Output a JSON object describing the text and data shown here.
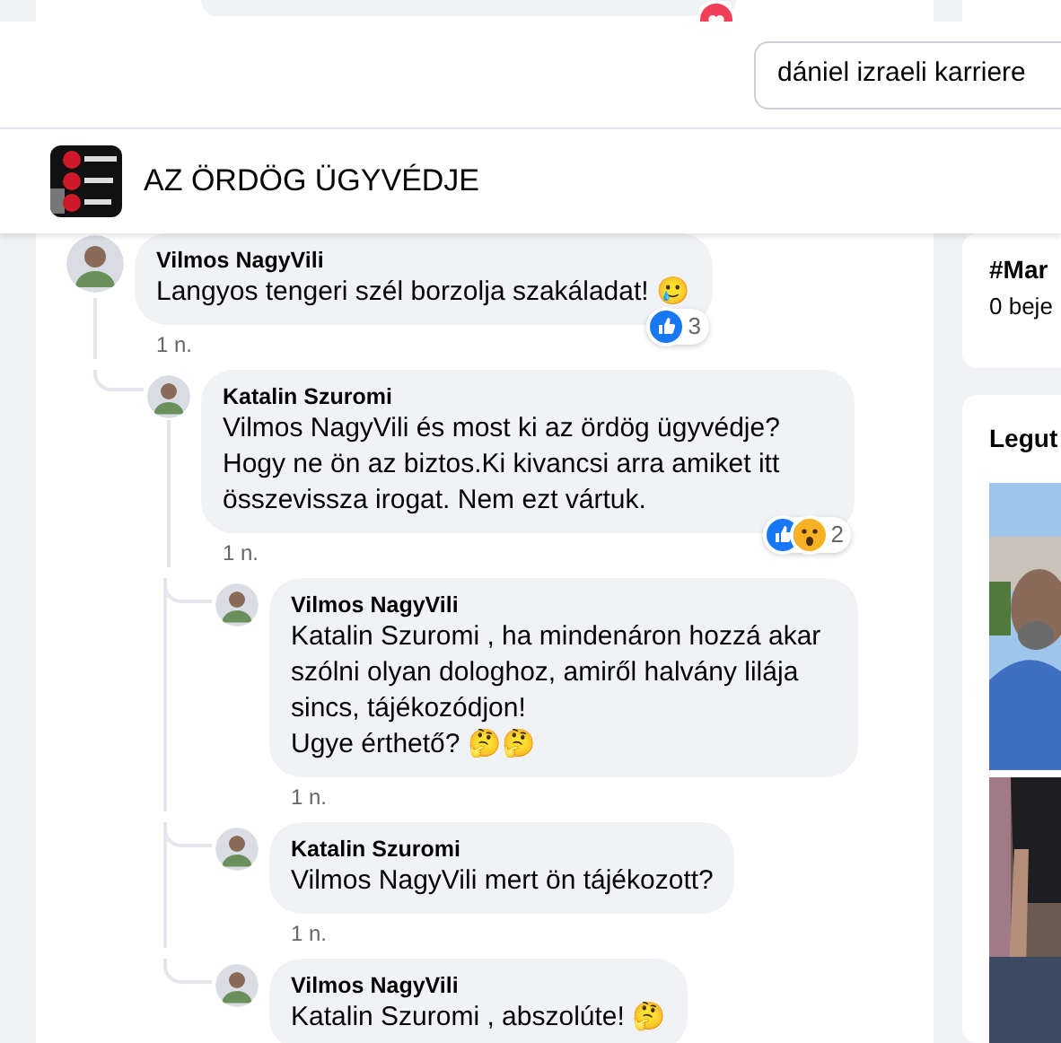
{
  "top_strip": {
    "reactions": [
      {
        "kind": "heart"
      }
    ]
  },
  "search": {
    "value": "dániel izraeli karriere"
  },
  "group": {
    "title": "AZ ÖRDÖG ÜGYVÉDJE"
  },
  "comments": [
    {
      "author": "Vilmos NagyVili",
      "text": "Langyos tengeri szél borzolja szakáladat! 🥲",
      "time": "1 n.",
      "reactions": [
        {
          "kind": "like"
        }
      ],
      "reaction_count": "3",
      "children": [
        {
          "author": "Katalin Szuromi",
          "text": "Vilmos NagyVili és most ki az ördög ügyvédje? Hogy ne ön az biztos.Ki kivancsi arra amiket itt összevissza irogat. Nem ezt vártuk.",
          "time": "1 n.",
          "reactions": [
            {
              "kind": "like"
            },
            {
              "kind": "wow"
            }
          ],
          "reaction_count": "2",
          "children": [
            {
              "author": "Vilmos NagyVili",
              "text": "Katalin Szuromi , ha mindenáron hozzá akar szólni olyan dologhoz, amiről halvány lilája sincs, tájékozódjon!\nUgye érthető? 🤔🤔",
              "time": "1 n."
            },
            {
              "author": "Katalin Szuromi",
              "text": "Vilmos NagyVili mert ön tájékozott?",
              "time": "1 n."
            },
            {
              "author": "Vilmos NagyVili",
              "text": "Katalin Szuromi , abszolúte! 🤔"
            }
          ]
        }
      ]
    }
  ],
  "sidebar": {
    "hashtag": {
      "title": "#Mar",
      "subtitle": "0 beje"
    },
    "recent": {
      "title": "Legut"
    }
  }
}
